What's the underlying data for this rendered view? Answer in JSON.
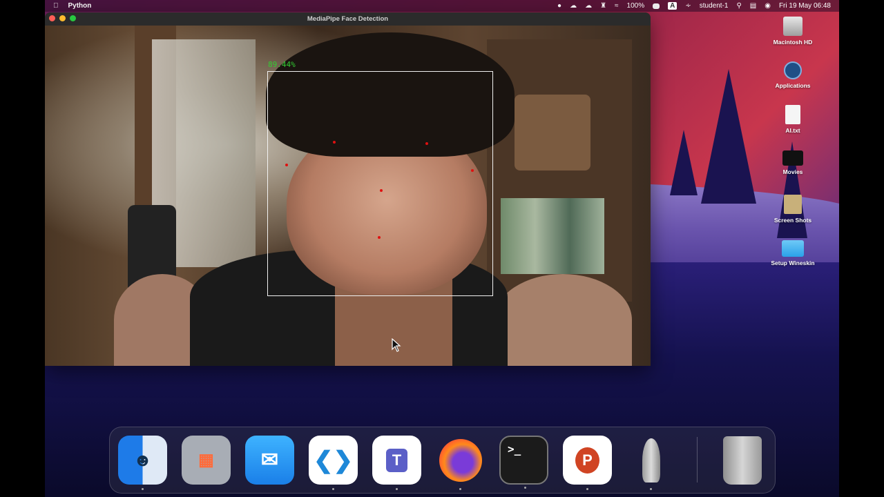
{
  "menubar": {
    "app_name": "Python",
    "battery": "100%",
    "user": "student-1",
    "datetime": "Fri 19 May  06:48",
    "input_source": "A"
  },
  "window": {
    "title": "MediaPipe Face Detection"
  },
  "detection": {
    "confidence_label": "89.44%"
  },
  "desktop_icons": [
    {
      "label": "Macintosh HD",
      "icon": "hard-drive-icon"
    },
    {
      "label": "Applications",
      "icon": "applications-icon"
    },
    {
      "label": "AI.txt",
      "icon": "text-file-icon"
    },
    {
      "label": "Movies",
      "icon": "movies-folder-icon"
    },
    {
      "label": "Screen Shots",
      "icon": "screenshots-folder-icon"
    },
    {
      "label": "Setup Wineskin",
      "icon": "folder-icon"
    }
  ],
  "dock": [
    {
      "name": "Finder",
      "icon": "finder-icon",
      "color": "#2f8cf0"
    },
    {
      "name": "Launchpad",
      "icon": "launchpad-icon",
      "color": "#9aa0a8"
    },
    {
      "name": "Mail",
      "icon": "mail-icon",
      "color": "#1e9bf0"
    },
    {
      "name": "Visual Studio Code",
      "icon": "vscode-icon",
      "color": "#ffffff"
    },
    {
      "name": "Microsoft Teams",
      "icon": "teams-icon",
      "color": "#ffffff"
    },
    {
      "name": "Firefox",
      "icon": "firefox-icon",
      "color": "#ff6a1a"
    },
    {
      "name": "Terminal",
      "icon": "terminal-icon",
      "color": "#1b1b1b"
    },
    {
      "name": "PowerPoint",
      "icon": "powerpoint-icon",
      "color": "#ffffff"
    },
    {
      "name": "Python Launcher",
      "icon": "python-rocket-icon",
      "color": "#3a3a3a"
    },
    {
      "name": "Trash",
      "icon": "trash-icon",
      "color": "#b9b9b9"
    }
  ]
}
